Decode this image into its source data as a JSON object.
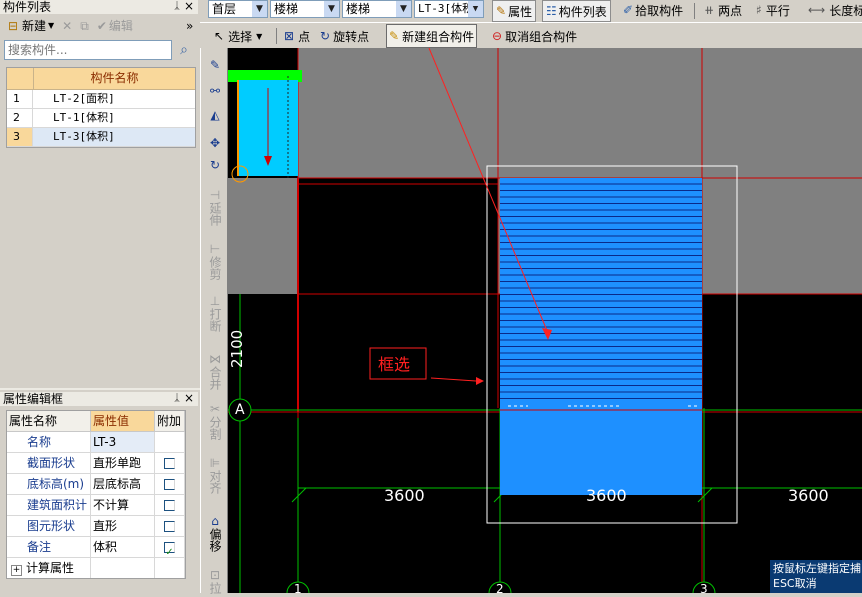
{
  "component_list": {
    "title": "构件列表",
    "toolbar": {
      "new": "新建",
      "edit": "编辑"
    },
    "search_placeholder": "搜索构件...",
    "column": "构件名称",
    "rows": [
      {
        "index": "1",
        "name": "LT-2[面积]"
      },
      {
        "index": "2",
        "name": "LT-1[体积]"
      },
      {
        "index": "3",
        "name": "LT-3[体积]"
      }
    ]
  },
  "properties": {
    "title": "属性编辑框",
    "headers": [
      "属性名称",
      "属性值",
      "附加"
    ],
    "rows": [
      {
        "name": "名称",
        "value": "LT-3",
        "checkbox": false,
        "has_checkbox": false
      },
      {
        "name": "截面形状",
        "value": "直形单跑",
        "checkbox": false,
        "has_checkbox": true
      },
      {
        "name": "底标高(m)",
        "value": "层底标高",
        "checkbox": false,
        "has_checkbox": true
      },
      {
        "name": "建筑面积计",
        "value": "不计算",
        "checkbox": false,
        "has_checkbox": true
      },
      {
        "name": "图元形状",
        "value": "直形",
        "checkbox": false,
        "has_checkbox": true
      },
      {
        "name": "备注",
        "value": "体积",
        "checkbox": true,
        "has_checkbox": true
      },
      {
        "name": "计算属性",
        "value": "",
        "checkbox": false,
        "has_checkbox": false
      }
    ]
  },
  "top_toolbar": {
    "floor": "首层",
    "category": "楼梯",
    "type": "楼梯",
    "component": "LT-3[体积",
    "attr": "属性",
    "list": "构件列表",
    "pick": "拾取构件",
    "two_points": "两点",
    "parallel": "平行",
    "length": "长度标"
  },
  "second_toolbar": {
    "select": "选择",
    "point": "点",
    "rotate_point": "旋转点",
    "new_group": "新建组合构件",
    "cancel_group": "取消组合构件"
  },
  "vertical_toolbar": [
    "延伸",
    "修剪",
    "打断",
    "合并",
    "分割",
    "对齐",
    "偏移",
    "拉"
  ],
  "canvas": {
    "annotation": "框选",
    "dim_left": "2100",
    "axis_a": "A",
    "dims_bottom": [
      "3600",
      "3600",
      "3600"
    ],
    "axes_bottom": [
      "1",
      "2",
      "3"
    ],
    "status_line1": "按鼠标左键指定捕",
    "status_line2": "ESC取消",
    "colors": {
      "blue": "#1e90ff",
      "red": "#ff0000",
      "gray": "#808080",
      "green": "#00ff00",
      "cyan": "#00ccff"
    }
  }
}
